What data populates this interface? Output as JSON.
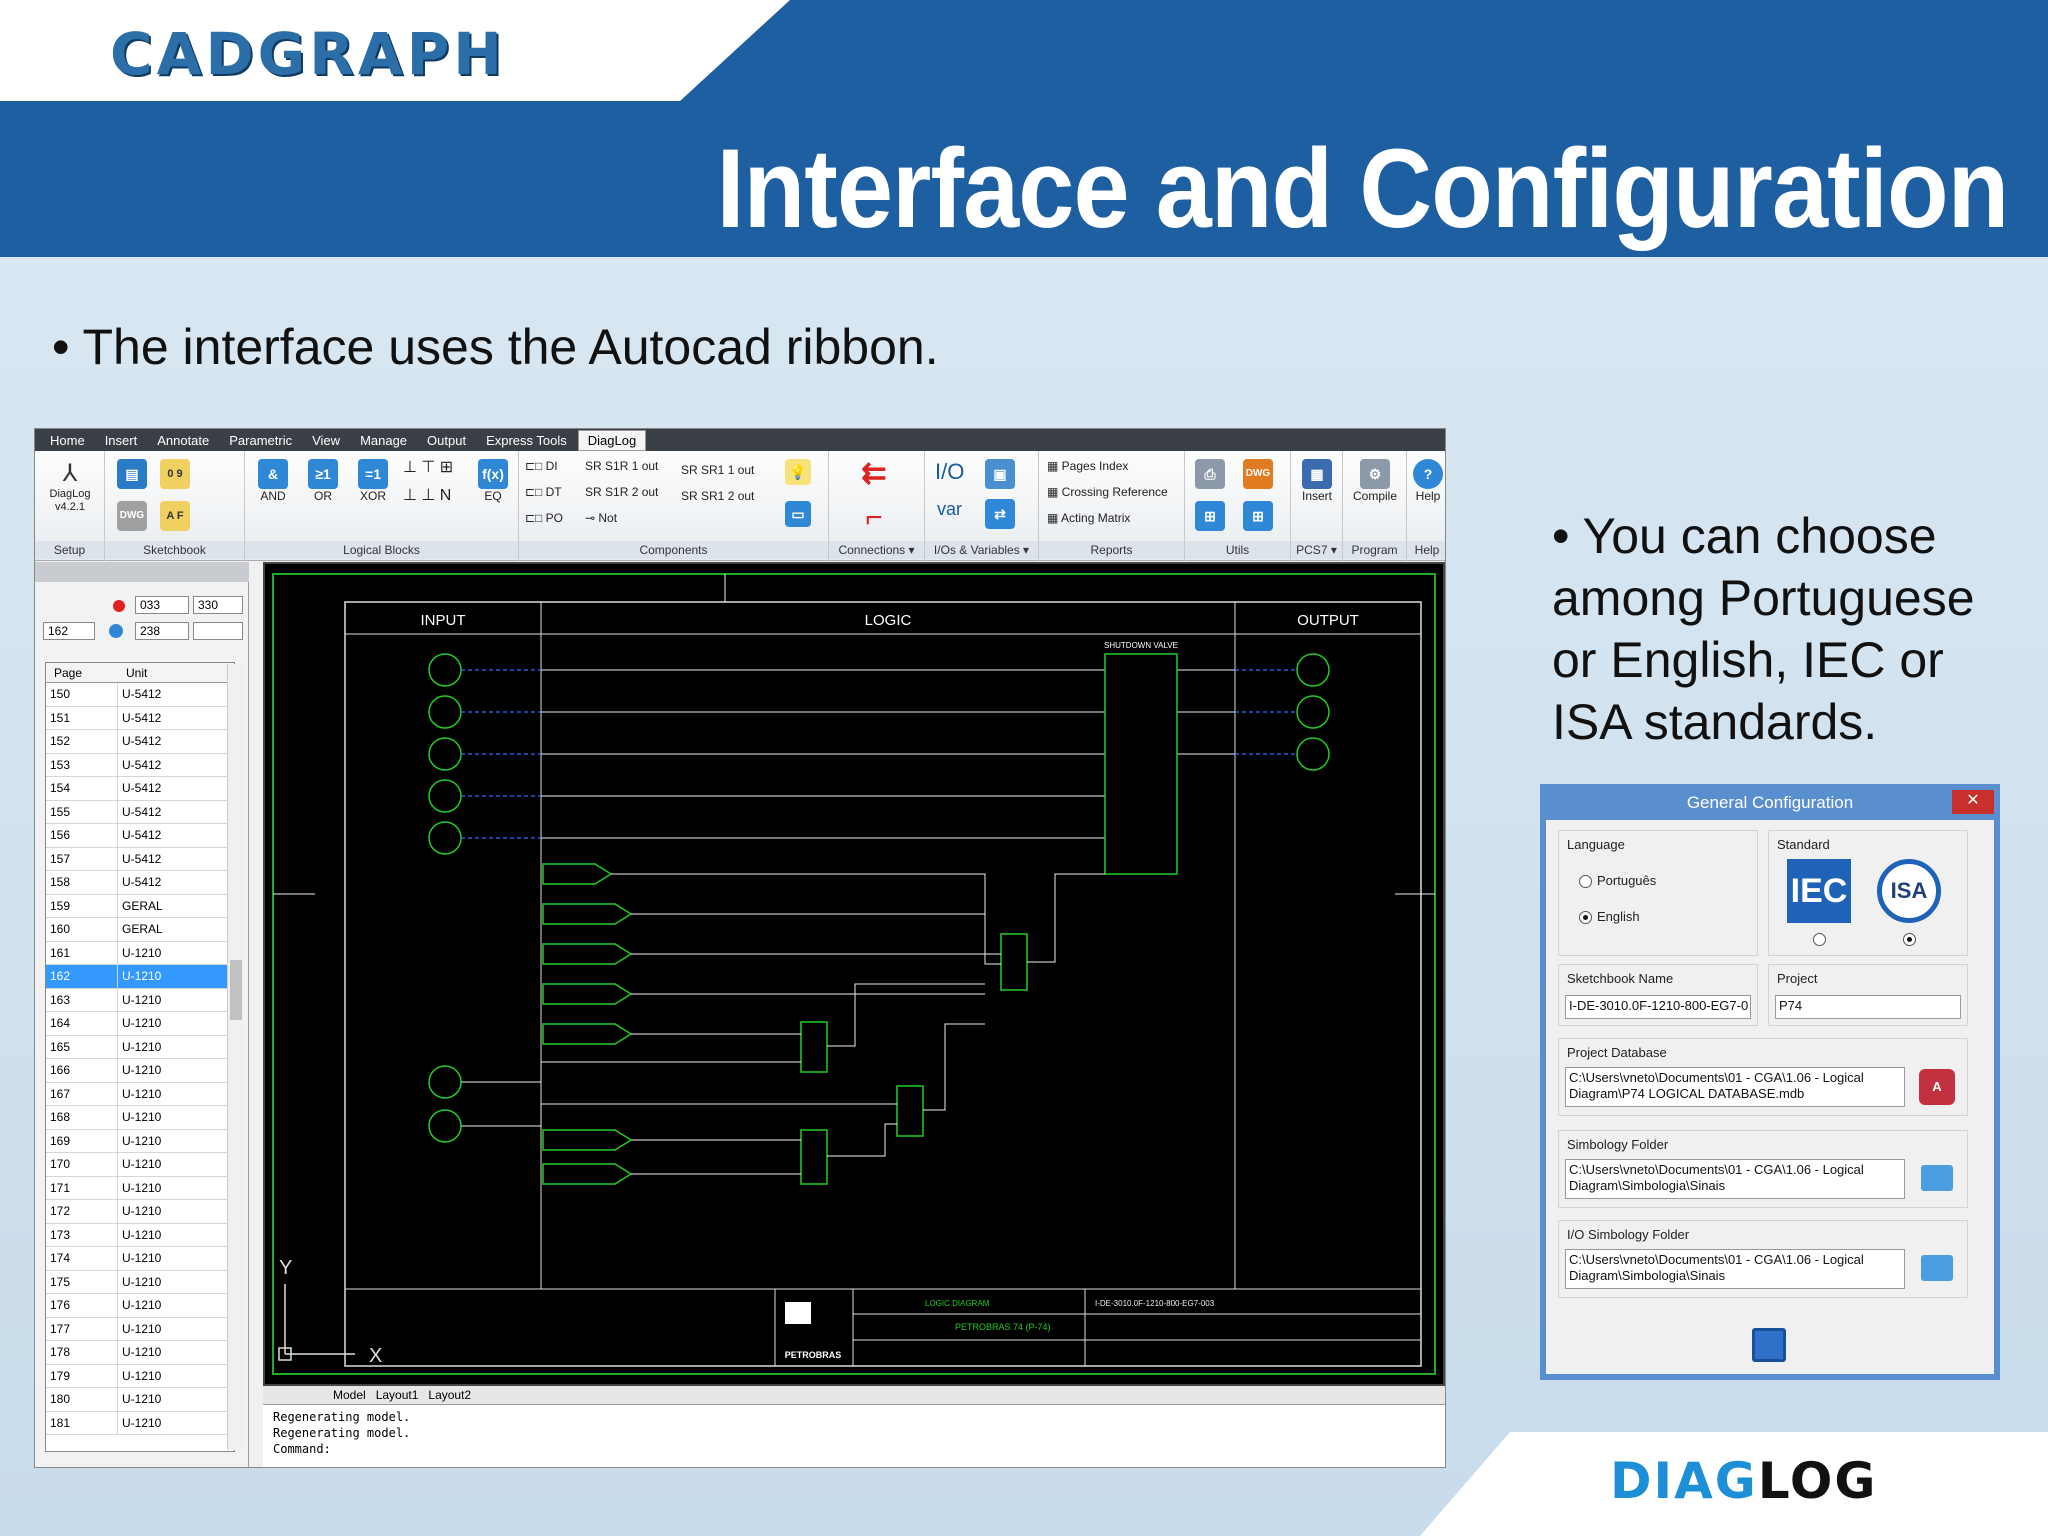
{
  "slide": {
    "brand": "CADGRAPH",
    "title": "Interface and Configuration",
    "bullet1": "• The interface uses the Autocad ribbon.",
    "bullet2": "• You can choose among Portuguese or English, IEC or ISA standards.",
    "footer_logo_a": "DIAG",
    "footer_logo_b": "LOG"
  },
  "app": {
    "tabs": [
      "Home",
      "Insert",
      "Annotate",
      "Parametric",
      "View",
      "Manage",
      "Output",
      "Express Tools",
      "DiagLog"
    ],
    "active_tab": "DiagLog",
    "ribbon": {
      "setup": {
        "btn": "DiagLog v4.2.1",
        "label": "Setup"
      },
      "sketchbook": {
        "label": "Sketchbook"
      },
      "logical_blocks": {
        "and": "AND",
        "or": "OR",
        "xor": "XOR",
        "eq": "EQ",
        "n": "N",
        "label": "Logical Blocks"
      },
      "components": {
        "di": "DI",
        "dt": "DT",
        "po": "PO",
        "s1r1": "S1R 1 out",
        "s1r2": "S1R 2 out",
        "not": "Not",
        "sr1": "SR1 1 out",
        "sr2": "SR1 2 out",
        "label": "Components"
      },
      "connections": {
        "label": "Connections ▾"
      },
      "ios": {
        "var": "var",
        "label": "I/Os & Variables ▾"
      },
      "reports": {
        "pages": "Pages Index",
        "crossing": "Crossing Reference",
        "acting": "Acting Matrix",
        "label": "Reports"
      },
      "utils": {
        "label": "Utils"
      },
      "pcs7": {
        "insert": "Insert",
        "label": "PCS7 ▾"
      },
      "program": {
        "compile": "Compile",
        "label": "Program"
      },
      "help": {
        "help": "Help",
        "label": "Help"
      }
    },
    "left_panel": {
      "page_field": "162",
      "f1": "033",
      "f2": "330",
      "f3": "238",
      "col_page": "Page",
      "col_unit": "Unit",
      "rows": [
        [
          "150",
          "U-5412"
        ],
        [
          "151",
          "U-5412"
        ],
        [
          "152",
          "U-5412"
        ],
        [
          "153",
          "U-5412"
        ],
        [
          "154",
          "U-5412"
        ],
        [
          "155",
          "U-5412"
        ],
        [
          "156",
          "U-5412"
        ],
        [
          "157",
          "U-5412"
        ],
        [
          "158",
          "U-5412"
        ],
        [
          "159",
          "GERAL"
        ],
        [
          "160",
          "GERAL"
        ],
        [
          "161",
          "U-1210"
        ],
        [
          "162",
          "U-1210"
        ],
        [
          "163",
          "U-1210"
        ],
        [
          "164",
          "U-1210"
        ],
        [
          "165",
          "U-1210"
        ],
        [
          "166",
          "U-1210"
        ],
        [
          "167",
          "U-1210"
        ],
        [
          "168",
          "U-1210"
        ],
        [
          "169",
          "U-1210"
        ],
        [
          "170",
          "U-1210"
        ],
        [
          "171",
          "U-1210"
        ],
        [
          "172",
          "U-1210"
        ],
        [
          "173",
          "U-1210"
        ],
        [
          "174",
          "U-1210"
        ],
        [
          "175",
          "U-1210"
        ],
        [
          "176",
          "U-1210"
        ],
        [
          "177",
          "U-1210"
        ],
        [
          "178",
          "U-1210"
        ],
        [
          "179",
          "U-1210"
        ],
        [
          "180",
          "U-1210"
        ],
        [
          "181",
          "U-1210"
        ]
      ],
      "selected_page": "162"
    },
    "cad": {
      "input": "INPUT",
      "logic": "LOGIC",
      "output": "OUTPUT",
      "valve": "SHUTDOWN VALVE",
      "footer_title": "LOGIC DIAGRAM",
      "footer_doc": "I-DE-3010.0F-1210-800-EG7-003",
      "footer_project": "PETROBRAS 74 (P-74)",
      "footer_company": "PETROBRAS",
      "axis_y": "Y",
      "axis_x": "X"
    },
    "layout_tabs": [
      "Model",
      "Layout1",
      "Layout2"
    ],
    "cmd_lines": [
      "Regenerating model.",
      "Regenerating model.",
      "Command:"
    ]
  },
  "dialog": {
    "title": "General Configuration",
    "language_label": "Language",
    "opt_pt": "Português",
    "opt_en": "English",
    "standard_label": "Standard",
    "std_iec": "IEC",
    "std_isa": "ISA",
    "sketchbook_label": "Sketchbook Name",
    "sketchbook_value": "I-DE-3010.0F-1210-800-EG7-0",
    "project_label": "Project",
    "project_value": "P74",
    "db_label": "Project Database",
    "db_value": "C:\\Users\\vneto\\Documents\\01 - CGA\\1.06 - Logical Diagram\\P74 LOGICAL DATABASE.mdb",
    "simb_label": "Simbology Folder",
    "simb_value": "C:\\Users\\vneto\\Documents\\01 - CGA\\1.06 - Logical Diagram\\Simbologia\\Sinais",
    "io_label": "I/O Simbology Folder",
    "io_value": "C:\\Users\\vneto\\Documents\\01 - CGA\\1.06 - Logical Diagram\\Simbologia\\Sinais"
  }
}
